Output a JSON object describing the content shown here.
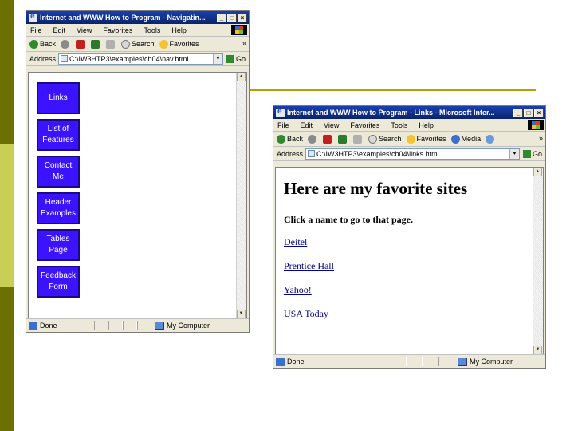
{
  "window_nav": {
    "title": "Internet and WWW How to Program - Navigatin...",
    "menu": [
      "File",
      "Edit",
      "View",
      "Favorites",
      "Tools",
      "Help"
    ],
    "toolbar": {
      "back": "Back",
      "search": "Search",
      "favorites": "Favorites",
      "more": "»"
    },
    "address_label": "Address",
    "address_value": "C:\\IW3HTP3\\examples\\ch04\\nav.html",
    "go_label": "Go",
    "nav_buttons": [
      "Links",
      "List of Features",
      "Contact Me",
      "Header Examples",
      "Tables Page",
      "Feedback Form"
    ],
    "status": "Done",
    "zone": "My Computer"
  },
  "window_links": {
    "title": "Internet and WWW How to Program - Links - Microsoft Inter...",
    "menu": [
      "File",
      "Edit",
      "View",
      "Favorites",
      "Tools",
      "Help"
    ],
    "toolbar": {
      "back": "Back",
      "search": "Search",
      "favorites": "Favorites",
      "media": "Media",
      "more": "»"
    },
    "address_label": "Address",
    "address_value": "C:\\IW3HTP3\\examples\\ch04\\links.html",
    "go_label": "Go",
    "heading": "Here are my favorite sites",
    "subheading": "Click a name to go to that page.",
    "links": [
      "Deitel",
      "Prentice Hall",
      "Yahoo!",
      "USA Today"
    ],
    "status": "Done",
    "zone": "My Computer"
  },
  "colors": {
    "olive_dark": "#6b7000",
    "olive_light": "#c9ce55",
    "accent_line": "#b8a200",
    "nav_button": "#3b13ff",
    "link": "#00008b"
  }
}
